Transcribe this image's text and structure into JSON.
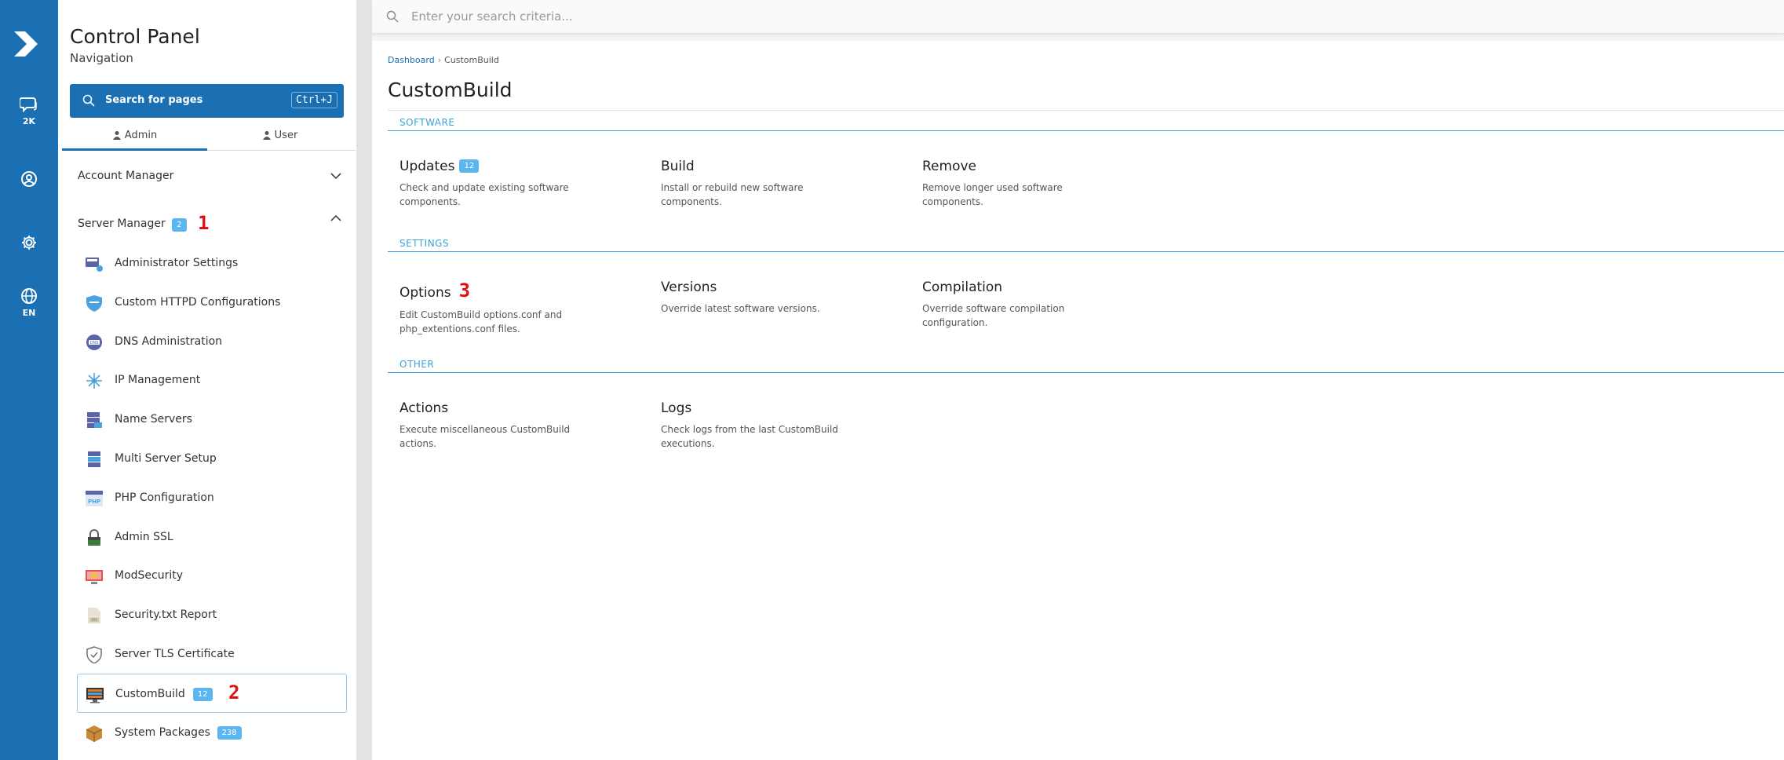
{
  "rail": {
    "items": [
      {
        "name": "messages",
        "label": "2K"
      },
      {
        "name": "user",
        "label": ""
      },
      {
        "name": "settings",
        "label": ""
      },
      {
        "name": "language",
        "label": "EN"
      }
    ]
  },
  "sidebar": {
    "title": "Control Panel",
    "subtitle": "Navigation",
    "search_label": "Search for pages",
    "search_shortcut": "Ctrl+J",
    "tabs": [
      {
        "label": "Admin"
      },
      {
        "label": "User"
      }
    ],
    "account_manager_label": "Account Manager",
    "server_manager_label": "Server Manager",
    "server_manager_badge": "2",
    "annotation_1": "1",
    "annotation_2": "2",
    "items": [
      {
        "label": "Administrator Settings",
        "icon": "admin-settings-icon",
        "badge": ""
      },
      {
        "label": "Custom HTTPD Configurations",
        "icon": "shield-icon",
        "badge": ""
      },
      {
        "label": "DNS Administration",
        "icon": "dns-icon",
        "badge": ""
      },
      {
        "label": "IP Management",
        "icon": "network-icon",
        "badge": ""
      },
      {
        "label": "Name Servers",
        "icon": "server-stack-icon",
        "badge": ""
      },
      {
        "label": "Multi Server Setup",
        "icon": "multi-server-icon",
        "badge": ""
      },
      {
        "label": "PHP Configuration",
        "icon": "php-icon",
        "badge": ""
      },
      {
        "label": "Admin SSL",
        "icon": "lock-icon",
        "badge": ""
      },
      {
        "label": "ModSecurity",
        "icon": "mod-security-icon",
        "badge": ""
      },
      {
        "label": "Security.txt Report",
        "icon": "txt-file-icon",
        "badge": ""
      },
      {
        "label": "Server TLS Certificate",
        "icon": "shield-check-icon",
        "badge": ""
      },
      {
        "label": "CustomBuild",
        "icon": "monitor-icon",
        "badge": "12"
      },
      {
        "label": "System Packages",
        "icon": "package-icon",
        "badge": "238"
      }
    ]
  },
  "topbar": {
    "search_placeholder": "Enter your search criteria..."
  },
  "main": {
    "breadcrumb": {
      "home": "Dashboard",
      "current": "CustomBuild"
    },
    "title": "CustomBuild",
    "annotation_3": "3",
    "sections": [
      {
        "title": "SOFTWARE",
        "cards": [
          {
            "title": "Updates",
            "badge": "12",
            "desc": "Check and update existing software components."
          },
          {
            "title": "Build",
            "desc": "Install or rebuild new software components."
          },
          {
            "title": "Remove",
            "desc": "Remove longer used software components."
          }
        ]
      },
      {
        "title": "SETTINGS",
        "cards": [
          {
            "title": "Options",
            "desc": "Edit CustomBuild options.conf and php_extentions.conf files."
          },
          {
            "title": "Versions",
            "desc": "Override latest software versions."
          },
          {
            "title": "Compilation",
            "desc": "Override software compilation configuration."
          }
        ]
      },
      {
        "title": "OTHER",
        "cards": [
          {
            "title": "Actions",
            "desc": "Execute miscellaneous CustomBuild actions."
          },
          {
            "title": "Logs",
            "desc": "Check logs from the last CustomBuild executions."
          }
        ]
      }
    ]
  },
  "colors": {
    "brand": "#1b6fb3",
    "accent": "#3ca3d6",
    "badge": "#5bb5ee",
    "annotation": "#e01010"
  }
}
